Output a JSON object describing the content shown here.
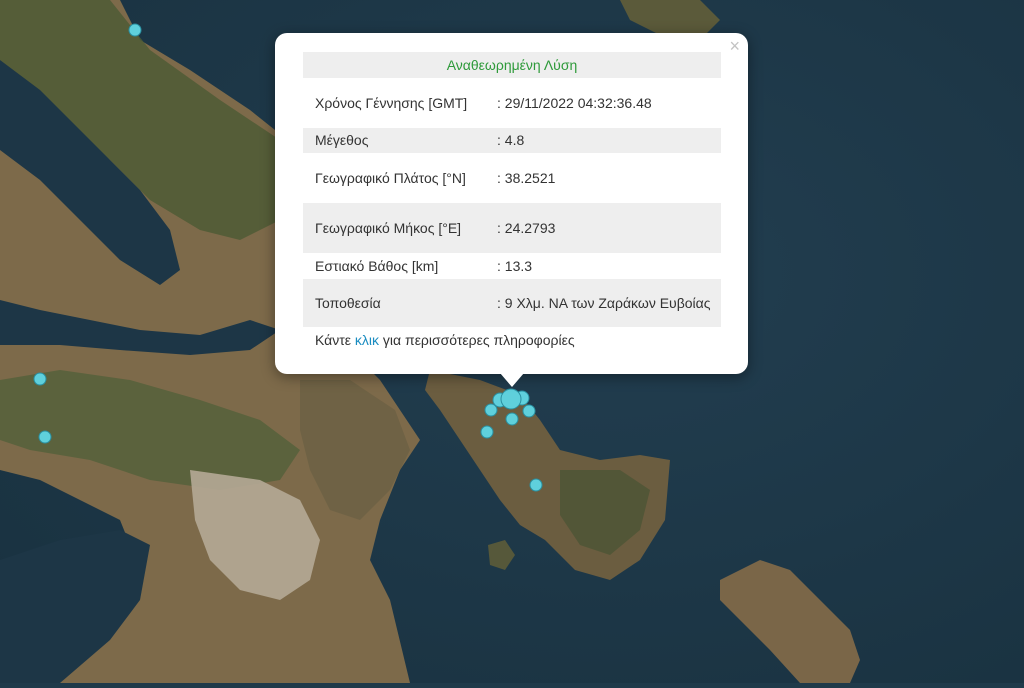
{
  "popup": {
    "title": "Αναθεωρημένη Λύση",
    "close_glyph": "×",
    "rows": [
      {
        "key": "Χρόνος Γέννησης [GMT]",
        "value": ": 29/11/2022 04:32:36.48"
      },
      {
        "key": "Μέγεθος",
        "value": ": 4.8"
      },
      {
        "key": "Γεωγραφικό Πλάτος [°N]",
        "value": ": 38.2521"
      },
      {
        "key": "Γεωγραφικό Μήκος [°E]",
        "value": ": 24.2793"
      },
      {
        "key": "Εστιακό Βάθος [km]",
        "value": ": 13.3"
      },
      {
        "key": "Τοποθεσία",
        "value": ": 9 Χλμ. ΝΑ των Ζαράκων Ευβοίας"
      }
    ],
    "footer_before": "Κάντε ",
    "footer_link": "κλικ",
    "footer_after": " για περισσότερες πληροφορίες"
  },
  "map": {
    "colors": {
      "sea": "#1f3a4a",
      "land": "#7a6a4c",
      "forest": "#4c5a34",
      "urban": "#b6ab98",
      "marker": "#5fd0dc"
    }
  }
}
